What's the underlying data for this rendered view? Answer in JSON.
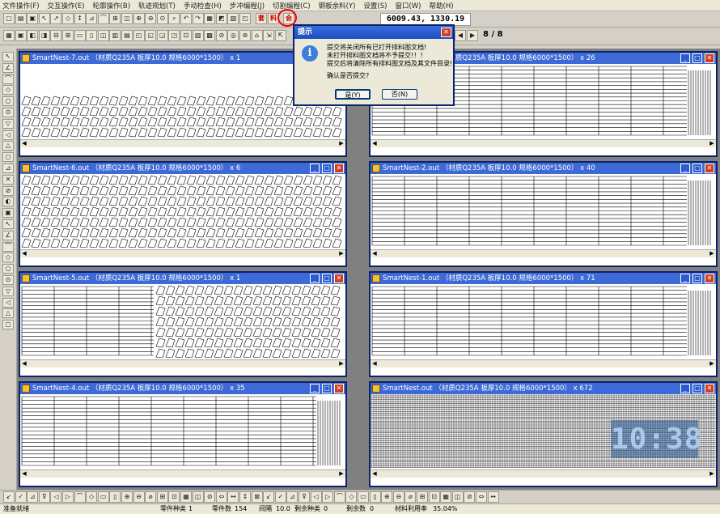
{
  "menu": [
    "文件操作(F)",
    "交互操作(E)",
    "轮廓操作(B)",
    "轨迹规划(T)",
    "手动检查(H)",
    "步冲编程(J)",
    "切割编程(C)",
    "钢板余料(Y)",
    "设置(S)",
    "窗口(W)",
    "帮助(H)"
  ],
  "toolbar": {
    "coords": "6009.43, 1330.19",
    "page": "8 / 8",
    "btn_red_1": "套",
    "btn_red_2": "料",
    "btn_submit": "会"
  },
  "windows": [
    {
      "title": "SmartNest-7.out （材质Q235A 板厚10.0 规格6000*1500） x 1",
      "pattern": "parts-top"
    },
    {
      "title": "SmartNest-3.out （材质Q235A 板厚10.0 规格6000*1500） x 26",
      "pattern": "strips"
    },
    {
      "title": "SmartNest-6.out （材质Q235A 板厚10.0 规格6000*1500） x 6",
      "pattern": "parts-full"
    },
    {
      "title": "SmartNest-2.out （材质Q235A 板厚10.0 规格6000*1500） x 40",
      "pattern": "strips"
    },
    {
      "title": "SmartNest-5.out （材质Q235A 板厚10.0 规格6000*1500） x 1",
      "pattern": "mixed"
    },
    {
      "title": "SmartNest-1.out （材质Q235A 板厚10.0 规格6000*1500） x 71",
      "pattern": "strips"
    },
    {
      "title": "SmartNest-4.out （材质Q235A 板厚10.0 规格6000*1500） x 35",
      "pattern": "strips"
    },
    {
      "title": "SmartNest.out （材质Q235A 板厚10.0 规格6000*1500） x 672",
      "pattern": "grid"
    }
  ],
  "dialog": {
    "title": "提示",
    "lines": [
      "提交将关闭所有已打开排料图文档!",
      "未打开排料图文档将不予提交!！！",
      "提交后将清除所有排料图文档及其文件目录!"
    ],
    "question": "确认是否提交?",
    "yes": "是(Y)",
    "no": "否(N)"
  },
  "clock": "10:38",
  "status": {
    "ready": "准备就绪",
    "part_types_label": "零件种类",
    "part_types": "1",
    "part_count_label": "零件数",
    "part_count": "154",
    "gap_label": "间隔",
    "gap": "10.0",
    "remain_types_label": "剩余种类",
    "remain_types": "0",
    "remain_count_label": "剩余数",
    "remain_count": "0",
    "utilization_label": "材料利用率",
    "utilization": "35.04%"
  },
  "colors": {
    "title_active": "#3d6ad6",
    "frame": "#0a246a",
    "close": "#d04020",
    "highlight_circle": "#e00000"
  }
}
